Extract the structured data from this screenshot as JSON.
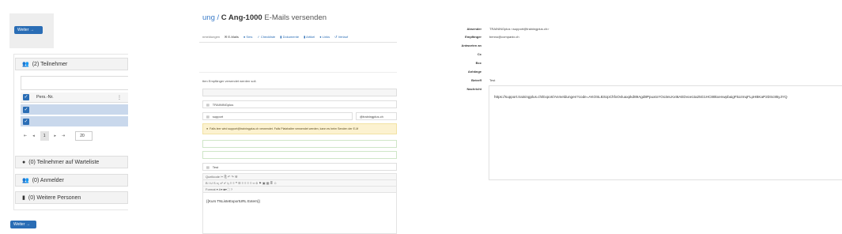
{
  "left": {
    "weiter_label": "Weiter →",
    "sections": {
      "teilnehmer": "(2) Teilnehmer",
      "warteliste": "(0) Teilnehmer auf Warteliste",
      "anmelder": "(0) Anmelder",
      "weitere": "(0) Weitere Personen"
    },
    "grid": {
      "column_label": "Pers.-Nr.",
      "column_menu": "⋮",
      "rows_selected": 2
    },
    "pager": {
      "first": "⇤",
      "prev": "◂",
      "current": "1",
      "next": "▸",
      "last": "⇥",
      "page_size": "20"
    },
    "colors": {
      "primary": "#2a6db5",
      "selected_row": "#c9d8ec"
    }
  },
  "middle": {
    "title_link": "ung / ",
    "title_id": "C Ang-1000",
    "title_rest": " E-Mails versenden",
    "tabs": [
      "nmeldungen",
      "✉ E-Mails",
      "● Sms",
      "✓ Checkliste",
      "▮ Dokumente",
      "▮ Artikel",
      "● Links",
      "↺ Verlauf"
    ],
    "info_text": "tten Empfänger versendet werden soll.",
    "fields": {
      "from_name": "TRAININGplus",
      "support": "support",
      "domain": "@trainingplus.ch",
      "subject": "Test"
    },
    "warning": "Falls leer wird support@trainingplus.ch verwendet. Falls Platzhalter verwendet werden, kann es beim Senden der E-M",
    "toolbar_1": "Quellcode   ✂ ⎘ ↶ ↷   ⚒",
    "toolbar_2": "B I U S x₂ x² ✔ Iₓ   ≡ ≡ ❝ ☰ ≡ ≡ ≡ ≡   ∞ ⦸ ⚑   ▣ ▦ ≣ ☺",
    "toolbar_3": "Format  ▾  A▾  ■▾  ⛶  ?",
    "editor_text": "{{Kurs TNListeExportURL Extern}}"
  },
  "right": {
    "labels": {
      "absender": "Absender",
      "empfaenger": "Empfänger",
      "antworten": "Antworten an",
      "cc": "Cc",
      "bcc": "Bcc",
      "anhaenge": "Anhänge",
      "betreff": "Betreff",
      "nachricht": "Nachricht"
    },
    "values": {
      "absender": "TRAININGplus <support@trainingplus.ch>",
      "empfaenger": "benno@companix.ch",
      "betreff": "Test"
    },
    "message_url": "https://support.trainingplus.ch/Export/Anmeldungen?code=AKOSL83UpChfoOvluaxpkd89Agd8PpuxtoYOo3eLKxt6AEDvoe1ta25G1HC88kxenwpbaigFkozmqFLpHBKaP2DSc85yJYQ"
  }
}
